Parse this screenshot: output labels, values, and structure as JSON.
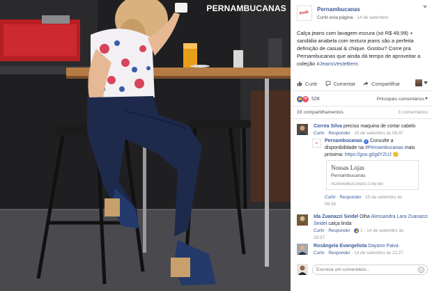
{
  "photo": {
    "brand_overlay": "PERNAMBUCANAS"
  },
  "post": {
    "page_name": "Pernambucanas",
    "follow_label": "Curtir esta página",
    "date": "14 de setembro",
    "text_main": "Calça jeans com lavagem escura (só R$ 49,99) + sandália anabela com textura jeans são a perfeita definição de casual & chique. Gostou? Corre pra Pernambucanas que ainda dá tempo de aproveitar a coleção",
    "hashtag": "#JeansVesteBem",
    "text_end": "."
  },
  "actions": {
    "like": "Curtir",
    "comment": "Comentar",
    "share": "Compartilhar"
  },
  "reactions": {
    "count": "528",
    "sort_label": "Principais comentários"
  },
  "stats": {
    "shares": "33 compartilhamentos",
    "comments": "3 comentários"
  },
  "comments": [
    {
      "author": "Correa Silva",
      "text": "preciso maquina de cortar cabelo",
      "like": "Curtir",
      "reply": "Responder",
      "time": "15 de setembro às 08:47"
    },
    {
      "author": "Pernambucanas",
      "text_a": "Consulte a disponibilidade na",
      "mention": "#Pernambucanas",
      "text_b": "mais próxima:",
      "link": "https://goo.gl/gdY2UJ",
      "emoji": "🙂",
      "preview_title": "Nossas Lojas",
      "preview_sub": "Pernambucanas",
      "preview_domain": "PERNAMBUCANAS.COM.BR",
      "like": "Curtir",
      "reply": "Responder",
      "time_a": "15 de setembro às",
      "time_b": "09:38"
    },
    {
      "author": "Ida Zuanazzi Seidel",
      "text_a": "Olha",
      "mention_a": "Alessandra Lara",
      "mention_b": "Zuanazzi Seidel",
      "text_b": "calça linda",
      "like": "Curtir",
      "reply": "Responder",
      "likes": "1",
      "time_a": "14 de setembro às",
      "time_b": "18:37"
    },
    {
      "author": "Rosângela Evangelista",
      "mention": "Dayano Paiva",
      "like": "Curtir",
      "reply": "Responder",
      "time": "14 de setembro às 22:27"
    }
  ],
  "composer": {
    "placeholder": "Escreva um comentário..."
  }
}
